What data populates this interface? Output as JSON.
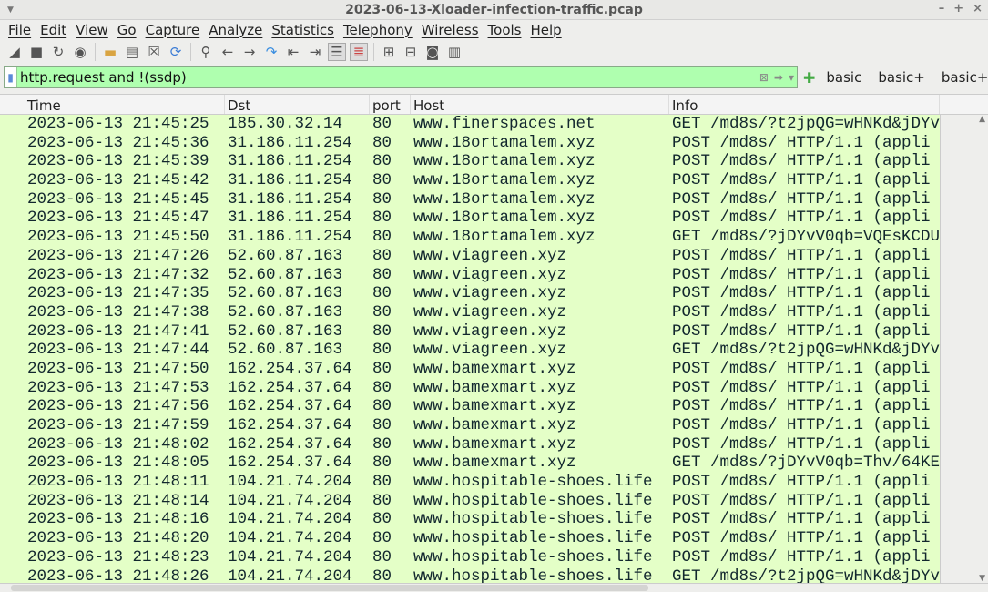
{
  "window": {
    "title": "2023-06-13-Xloader-infection-traffic.pcap"
  },
  "menu": [
    "File",
    "Edit",
    "View",
    "Go",
    "Capture",
    "Analyze",
    "Statistics",
    "Telephony",
    "Wireless",
    "Tools",
    "Help"
  ],
  "filter": {
    "value": "http.request and !(ssdp)",
    "buttons": [
      "basic",
      "basic+",
      "basic+dns"
    ]
  },
  "columns": [
    "Time",
    "Dst",
    "port",
    "Host",
    "Info"
  ],
  "rows": [
    [
      "2023-06-13 21:45:25",
      "185.30.32.14",
      "80",
      "www.finerspaces.net",
      "GET /md8s/?t2jpQG=wHNKd&jDYv"
    ],
    [
      "2023-06-13 21:45:36",
      "31.186.11.254",
      "80",
      "www.18ortamalem.xyz",
      "POST /md8s/ HTTP/1.1  (appli"
    ],
    [
      "2023-06-13 21:45:39",
      "31.186.11.254",
      "80",
      "www.18ortamalem.xyz",
      "POST /md8s/ HTTP/1.1  (appli"
    ],
    [
      "2023-06-13 21:45:42",
      "31.186.11.254",
      "80",
      "www.18ortamalem.xyz",
      "POST /md8s/ HTTP/1.1  (appli"
    ],
    [
      "2023-06-13 21:45:45",
      "31.186.11.254",
      "80",
      "www.18ortamalem.xyz",
      "POST /md8s/ HTTP/1.1  (appli"
    ],
    [
      "2023-06-13 21:45:47",
      "31.186.11.254",
      "80",
      "www.18ortamalem.xyz",
      "POST /md8s/ HTTP/1.1  (appli"
    ],
    [
      "2023-06-13 21:45:50",
      "31.186.11.254",
      "80",
      "www.18ortamalem.xyz",
      "GET /md8s/?jDYvV0qb=VQEsKCDU"
    ],
    [
      "2023-06-13 21:47:26",
      "52.60.87.163",
      "80",
      "www.viagreen.xyz",
      "POST /md8s/ HTTP/1.1  (appli"
    ],
    [
      "2023-06-13 21:47:32",
      "52.60.87.163",
      "80",
      "www.viagreen.xyz",
      "POST /md8s/ HTTP/1.1  (appli"
    ],
    [
      "2023-06-13 21:47:35",
      "52.60.87.163",
      "80",
      "www.viagreen.xyz",
      "POST /md8s/ HTTP/1.1  (appli"
    ],
    [
      "2023-06-13 21:47:38",
      "52.60.87.163",
      "80",
      "www.viagreen.xyz",
      "POST /md8s/ HTTP/1.1  (appli"
    ],
    [
      "2023-06-13 21:47:41",
      "52.60.87.163",
      "80",
      "www.viagreen.xyz",
      "POST /md8s/ HTTP/1.1  (appli"
    ],
    [
      "2023-06-13 21:47:44",
      "52.60.87.163",
      "80",
      "www.viagreen.xyz",
      "GET /md8s/?t2jpQG=wHNKd&jDYv"
    ],
    [
      "2023-06-13 21:47:50",
      "162.254.37.64",
      "80",
      "www.bamexmart.xyz",
      "POST /md8s/ HTTP/1.1  (appli"
    ],
    [
      "2023-06-13 21:47:53",
      "162.254.37.64",
      "80",
      "www.bamexmart.xyz",
      "POST /md8s/ HTTP/1.1  (appli"
    ],
    [
      "2023-06-13 21:47:56",
      "162.254.37.64",
      "80",
      "www.bamexmart.xyz",
      "POST /md8s/ HTTP/1.1  (appli"
    ],
    [
      "2023-06-13 21:47:59",
      "162.254.37.64",
      "80",
      "www.bamexmart.xyz",
      "POST /md8s/ HTTP/1.1  (appli"
    ],
    [
      "2023-06-13 21:48:02",
      "162.254.37.64",
      "80",
      "www.bamexmart.xyz",
      "POST /md8s/ HTTP/1.1  (appli"
    ],
    [
      "2023-06-13 21:48:05",
      "162.254.37.64",
      "80",
      "www.bamexmart.xyz",
      "GET /md8s/?jDYvV0qb=Thv/64KE"
    ],
    [
      "2023-06-13 21:48:11",
      "104.21.74.204",
      "80",
      "www.hospitable-shoes.life",
      "POST /md8s/ HTTP/1.1  (appli"
    ],
    [
      "2023-06-13 21:48:14",
      "104.21.74.204",
      "80",
      "www.hospitable-shoes.life",
      "POST /md8s/ HTTP/1.1  (appli"
    ],
    [
      "2023-06-13 21:48:16",
      "104.21.74.204",
      "80",
      "www.hospitable-shoes.life",
      "POST /md8s/ HTTP/1.1  (appli"
    ],
    [
      "2023-06-13 21:48:20",
      "104.21.74.204",
      "80",
      "www.hospitable-shoes.life",
      "POST /md8s/ HTTP/1.1  (appli"
    ],
    [
      "2023-06-13 21:48:23",
      "104.21.74.204",
      "80",
      "www.hospitable-shoes.life",
      "POST /md8s/ HTTP/1.1  (appli"
    ],
    [
      "2023-06-13 21:48:26",
      "104.21.74.204",
      "80",
      "www.hospitable-shoes.life",
      "GET /md8s/?t2jpQG=wHNKd&jDYv"
    ]
  ],
  "colors": {
    "row_bg": "#e4ffc7",
    "filter_bg": "#afffaf"
  }
}
